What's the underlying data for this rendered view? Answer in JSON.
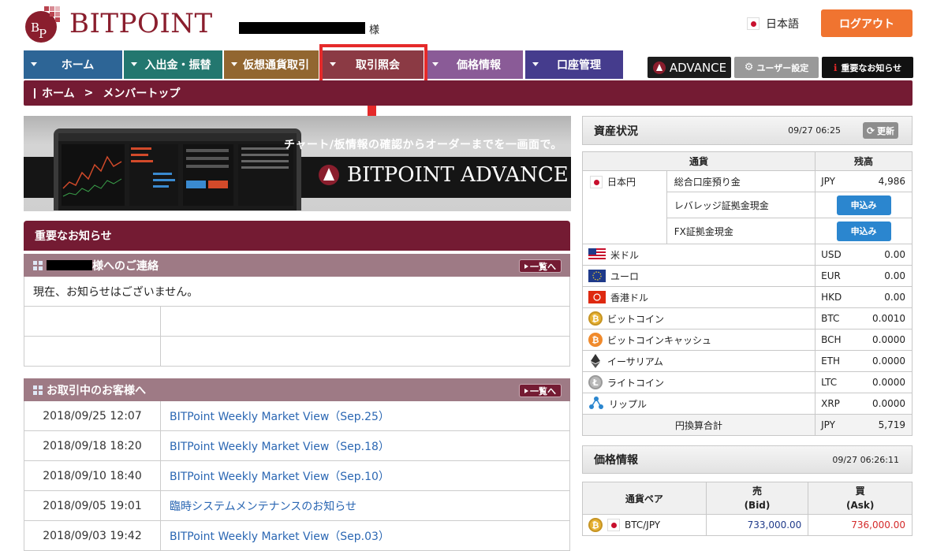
{
  "header": {
    "logo_text": "BITPOINT",
    "user_suffix": "様",
    "language": "日本語",
    "logout_label": "ログアウト"
  },
  "nav": {
    "items": [
      {
        "label": "ホーム",
        "color": "#2d6596"
      },
      {
        "label": "入出金・振替",
        "color": "#23776f"
      },
      {
        "label": "仮想通貨取引",
        "color": "#926630"
      },
      {
        "label": "取引照会",
        "color": "#8b3a44"
      },
      {
        "label": "価格情報",
        "color": "#8a5b97"
      },
      {
        "label": "口座管理",
        "color": "#453c8d"
      }
    ],
    "advance_label": "ADVANCE",
    "user_settings_label": "ユーザー設定",
    "important_notice_label": "重要なお知らせ"
  },
  "breadcrumb": {
    "home": "ホーム",
    "separator": ">",
    "current": "メンバートップ"
  },
  "banner": {
    "tagline": "チャート/板情報の確認からオーダーまでを一画面で。",
    "brand": "BITPOINT ADVANCE"
  },
  "notices": {
    "section_title": "重要なお知らせ",
    "personal": {
      "title_suffix": "様へのご連絡",
      "more_label": "一覧へ",
      "empty_message": "現在、お知らせはございません。"
    },
    "customers": {
      "title": "お取引中のお客様へ",
      "more_label": "一覧へ",
      "items": [
        {
          "date": "2018/09/25 12:07",
          "title": "BITPoint Weekly Market View（Sep.25）"
        },
        {
          "date": "2018/09/18 18:20",
          "title": "BITPoint Weekly Market View（Sep.18）"
        },
        {
          "date": "2018/09/10 18:40",
          "title": "BITPoint Weekly Market View（Sep.10）"
        },
        {
          "date": "2018/09/05 19:01",
          "title": "臨時システムメンテナンスのお知らせ"
        },
        {
          "date": "2018/09/03 19:42",
          "title": "BITPoint Weekly Market View（Sep.03）"
        }
      ]
    }
  },
  "assets": {
    "title": "資産状況",
    "timestamp": "09/27 06:25",
    "refresh_label": "更新",
    "col_currency": "通貨",
    "col_balance": "残高",
    "jpy": {
      "name": "日本円",
      "rows": [
        {
          "label": "総合口座預り金",
          "code": "JPY",
          "value": "4,986"
        },
        {
          "label": "レバレッジ証拠金現金",
          "button": "申込み"
        },
        {
          "label": "FX証拠金現金",
          "button": "申込み"
        }
      ]
    },
    "rows": [
      {
        "name": "米ドル",
        "code": "USD",
        "value": "0.00",
        "icon": "us-flag-icon"
      },
      {
        "name": "ユーロ",
        "code": "EUR",
        "value": "0.00",
        "icon": "eu-flag-icon"
      },
      {
        "name": "香港ドル",
        "code": "HKD",
        "value": "0.00",
        "icon": "hk-flag-icon"
      },
      {
        "name": "ビットコイン",
        "code": "BTC",
        "value": "0.0010",
        "icon": "bitcoin-icon"
      },
      {
        "name": "ビットコインキャッシュ",
        "code": "BCH",
        "value": "0.0000",
        "icon": "bitcoin-cash-icon"
      },
      {
        "name": "イーサリアム",
        "code": "ETH",
        "value": "0.0000",
        "icon": "ethereum-icon"
      },
      {
        "name": "ライトコイン",
        "code": "LTC",
        "value": "0.0000",
        "icon": "litecoin-icon"
      },
      {
        "name": "リップル",
        "code": "XRP",
        "value": "0.0000",
        "icon": "ripple-icon"
      }
    ],
    "total": {
      "label": "円換算合計",
      "code": "JPY",
      "value": "5,719"
    }
  },
  "prices": {
    "title": "価格情報",
    "timestamp": "09/27 06:26:11",
    "col_pair": "通貨ペア",
    "col_sell": "売",
    "col_sell_sub": "(Bid)",
    "col_buy": "買",
    "col_buy_sub": "(Ask)",
    "rows": [
      {
        "pair": "BTC/JPY",
        "bid": "733,000.00",
        "ask": "736,000.00"
      }
    ]
  },
  "colors": {
    "brand": "#741b33",
    "logout": "#f07430",
    "highlight": "#e52a2a",
    "link": "#2b67b3",
    "apply": "#2b86cf",
    "bid": "#1f3a8a",
    "ask": "#d42a2a"
  }
}
